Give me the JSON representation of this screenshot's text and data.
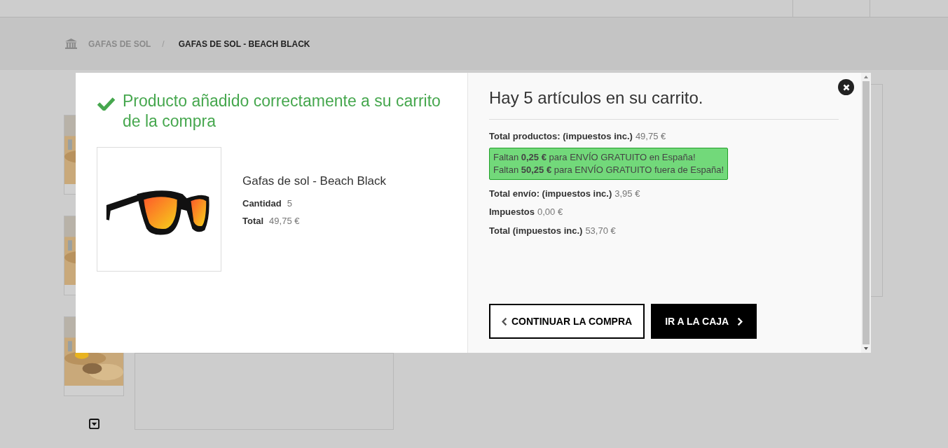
{
  "breadcrumb": {
    "separator": "/",
    "items": [
      {
        "label": "GAFAS DE SOL",
        "selected": false
      },
      {
        "label": "GAFAS DE SOL - BEACH BLACK",
        "selected": true
      }
    ]
  },
  "modal": {
    "message": "Producto añadido correctamente a su carrito de la compra",
    "product": {
      "name": "Gafas de sol - Beach Black",
      "details": [
        {
          "label": "Cantidad",
          "value": "5"
        },
        {
          "label": "Total",
          "value": "49,75 €"
        }
      ]
    },
    "cart_heading": "Hay 5 artículos en su carrito.",
    "summary_top": [
      {
        "label": "Total productos: (impuestos inc.)",
        "value": "49,75 €"
      }
    ],
    "notice": [
      "Faltan **0,25 €** para ENVÍO GRATUITO en España!",
      "Faltan **50,25 €** para ENVÍO GRATUITO fuera de España!"
    ],
    "summary_bottom": [
      {
        "label": "Total envío: (impuestos inc.)",
        "value": "3,95 €"
      },
      {
        "label": "Impuestos",
        "value": "0,00 €"
      },
      {
        "label": "Total (impuestos inc.)",
        "value": "53,70 €"
      }
    ],
    "buttons": [
      {
        "label": "CONTINUAR LA COMPRA",
        "kind": "back"
      },
      {
        "label": "IR A LA CAJA",
        "kind": "forward"
      }
    ]
  }
}
